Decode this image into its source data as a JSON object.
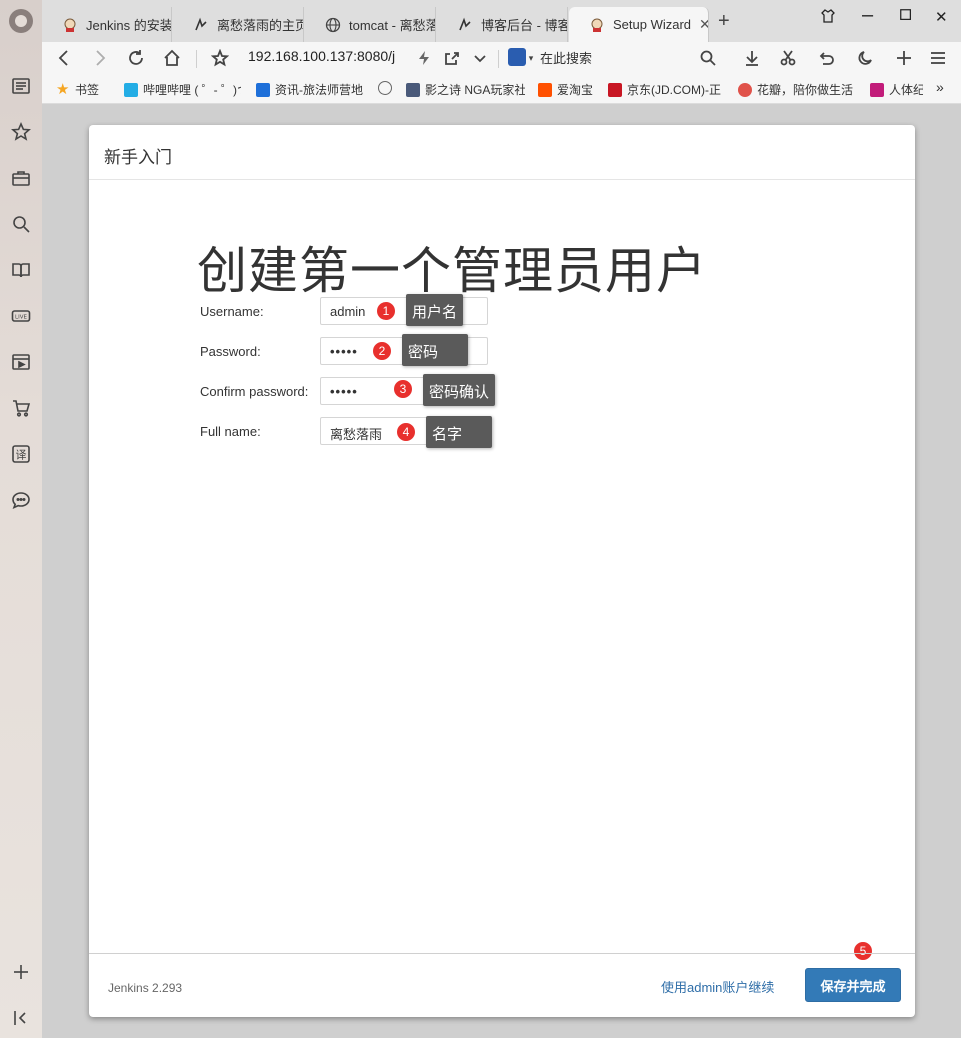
{
  "browser": {
    "tabs": [
      {
        "label": "Jenkins 的安装和",
        "icon": "jenkins-icon"
      },
      {
        "label": "离愁落雨的主页",
        "icon": "cnblogs-icon"
      },
      {
        "label": "tomcat - 离愁落",
        "icon": "globe-icon"
      },
      {
        "label": "博客后台 - 博客",
        "icon": "cnblogs-icon"
      },
      {
        "label": "Setup Wizard",
        "icon": "jenkins-icon"
      }
    ],
    "url": "192.168.100.137:8080/j",
    "search_placeholder": "在此搜索",
    "bookmarks": [
      {
        "label": "书签",
        "color": "#f5a623"
      },
      {
        "label": "哔哩哔哩 ( ゜- ゜)つ",
        "color": "#23ade5"
      },
      {
        "label": "资讯-旅法师营地",
        "color": "#1e6fd9"
      },
      {
        "label": "",
        "color": "#666666"
      },
      {
        "label": "影之诗 NGA玩家社",
        "color": "#4a5a7a"
      },
      {
        "label": "爱淘宝",
        "color": "#ff5000"
      },
      {
        "label": "京东(JD.COM)-正",
        "color": "#c81623"
      },
      {
        "label": "花瓣，陪你做生活",
        "color": "#e0524a"
      },
      {
        "label": "人体纪",
        "color": "#c21c7a"
      }
    ]
  },
  "wizard": {
    "header": "新手入门",
    "title": "创建第一个管理员用户",
    "fields": [
      {
        "label": "Username:",
        "value": "admin",
        "badge": "1",
        "callout": "用户名"
      },
      {
        "label": "Password:",
        "value": "•••••",
        "badge": "2",
        "callout": "密码"
      },
      {
        "label": "Confirm password:",
        "value": "•••••",
        "badge": "3",
        "callout": "密码确认"
      },
      {
        "label": "Full name:",
        "value": "离愁落雨",
        "badge": "4",
        "callout": "名字"
      }
    ],
    "footer": {
      "version": "Jenkins 2.293",
      "continue_link": "使用admin账户继续",
      "save_button": "保存并完成",
      "save_badge": "5"
    }
  }
}
